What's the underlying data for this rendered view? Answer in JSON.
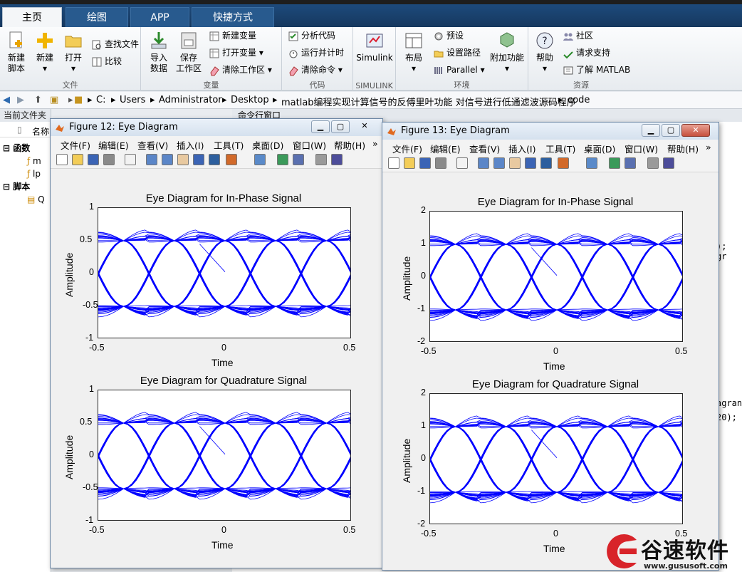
{
  "tabs": [
    {
      "label": "主页"
    },
    {
      "label": "绘图"
    },
    {
      "label": "APP"
    },
    {
      "label": "快捷方式"
    }
  ],
  "ribbon": {
    "file": {
      "label": "文件",
      "new_script": "新建\n脚本",
      "new": "新建",
      "open": "打开",
      "find_files": "查找文件",
      "compare": "比较"
    },
    "variable": {
      "label": "变量",
      "import": "导入\n数据",
      "save": "保存\n工作区",
      "new_var": "新建变量",
      "open_var": "打开变量",
      "clear_ws": "清除工作区"
    },
    "code": {
      "label": "代码",
      "analyze": "分析代码",
      "run_time": "运行并计时",
      "clear_cmd": "清除命令"
    },
    "simulink": {
      "label": "SIMULINK",
      "btn": "Simulink"
    },
    "env": {
      "label": "环境",
      "layout": "布局",
      "prefs": "预设",
      "set_path": "设置路径",
      "parallel": "Parallel",
      "addons": "附加功能"
    },
    "resources": {
      "label": "资源",
      "help": "帮助",
      "community": "社区",
      "support": "请求支持",
      "learn": "了解 MATLAB"
    }
  },
  "address": {
    "drive": "C:",
    "p1": "Users",
    "p2": "Administrator",
    "p3": "Desktop",
    "p4": "matlab编程实现计算信号的反傅里叶功能 对信号进行低通滤波源码程序",
    "p5": "code"
  },
  "left_panel": {
    "header": "当前文件夹",
    "col_name": "名称",
    "group_func": "函数",
    "file1": "m",
    "file2": "lp",
    "group_script": "脚本",
    "file3": "Q"
  },
  "command": {
    "header": "命令行窗口",
    "line1": "); gr",
    "line2": "agran",
    "line3": "20);"
  },
  "fig12": {
    "title": "Figure 12: Eye Diagram"
  },
  "fig13": {
    "title": "Figure 13: Eye Diagram"
  },
  "menus": [
    "文件(F)",
    "编辑(E)",
    "查看(V)",
    "插入(I)",
    "工具(T)",
    "桌面(D)",
    "窗口(W)",
    "帮助(H)"
  ],
  "plots": {
    "in_phase": "Eye Diagram for In-Phase Signal",
    "quadrature": "Eye Diagram for Quadrature Signal",
    "xlabel": "Time",
    "ylabel": "Amplitude"
  },
  "chart_data": [
    {
      "type": "line",
      "title": "Eye Diagram for In-Phase Signal",
      "xlabel": "Time",
      "ylabel": "Amplitude",
      "xlim": [
        -0.5,
        0.5
      ],
      "ylim": [
        -1,
        1
      ],
      "xticks": [
        "-0.5",
        "0",
        "0.5"
      ],
      "yticks": [
        "-1",
        "-0.5",
        "0",
        "0.5",
        "1"
      ],
      "levels": [
        -0.5,
        0.5
      ],
      "color": "#0000ff"
    },
    {
      "type": "line",
      "title": "Eye Diagram for Quadrature Signal",
      "xlabel": "Time",
      "ylabel": "Amplitude",
      "xlim": [
        -0.5,
        0.5
      ],
      "ylim": [
        -1,
        1
      ],
      "xticks": [
        "-0.5",
        "0",
        "0.5"
      ],
      "yticks": [
        "-1",
        "-0.5",
        "0",
        "0.5",
        "1"
      ],
      "levels": [
        -0.5,
        0.5
      ],
      "color": "#0000ff"
    },
    {
      "type": "line",
      "title": "Eye Diagram for In-Phase Signal",
      "xlabel": "Time",
      "ylabel": "Amplitude",
      "xlim": [
        -0.5,
        0.5
      ],
      "ylim": [
        -2,
        2
      ],
      "xticks": [
        "-0.5",
        "0",
        "0.5"
      ],
      "yticks": [
        "-2",
        "-1",
        "0",
        "1",
        "2"
      ],
      "levels": [
        -1,
        1
      ],
      "color": "#0000ff"
    },
    {
      "type": "line",
      "title": "Eye Diagram for Quadrature Signal",
      "xlabel": "Time",
      "ylabel": "Amplitude",
      "xlim": [
        -0.5,
        0.5
      ],
      "ylim": [
        -2,
        2
      ],
      "xticks": [
        "-0.5",
        "0",
        "0.5"
      ],
      "yticks": [
        "-2",
        "-1",
        "0",
        "1",
        "2"
      ],
      "levels": [
        -1,
        1
      ],
      "color": "#0000ff"
    }
  ],
  "watermark": {
    "brand": "谷速软件",
    "url": "www.gususoft.com"
  }
}
